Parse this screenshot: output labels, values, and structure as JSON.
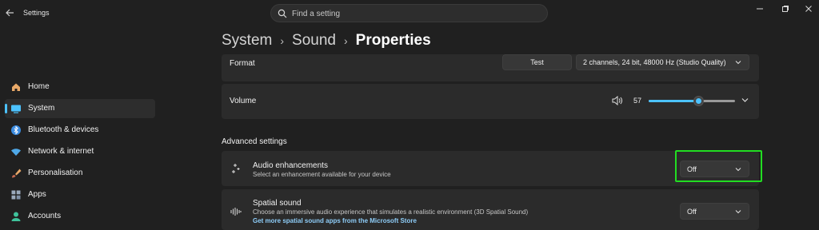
{
  "window": {
    "title": "Settings",
    "controls": [
      "minimize",
      "maximize",
      "close"
    ]
  },
  "search": {
    "placeholder": "Find a setting",
    "value": ""
  },
  "sidebar": {
    "items": [
      {
        "label": "Home",
        "icon": "home-icon",
        "active": false
      },
      {
        "label": "System",
        "icon": "monitor-icon",
        "active": true
      },
      {
        "label": "Bluetooth & devices",
        "icon": "bluetooth-icon",
        "active": false
      },
      {
        "label": "Network & internet",
        "icon": "wifi-icon",
        "active": false
      },
      {
        "label": "Personalisation",
        "icon": "brush-icon",
        "active": false
      },
      {
        "label": "Apps",
        "icon": "apps-icon",
        "active": false
      },
      {
        "label": "Accounts",
        "icon": "person-icon",
        "active": false
      }
    ]
  },
  "breadcrumb": [
    "System",
    "Sound",
    "Properties"
  ],
  "format": {
    "label": "Format",
    "test_label": "Test",
    "selected": "2 channels, 24 bit, 48000 Hz (Studio Quality)"
  },
  "volume": {
    "label": "Volume",
    "value": "57",
    "level": 0.57
  },
  "advanced": {
    "title": "Advanced settings",
    "audio_enhancements": {
      "label": "Audio enhancements",
      "description": "Select an enhancement available for your device",
      "selected": "Off"
    },
    "spatial_sound": {
      "label": "Spatial sound",
      "description": "Choose an immersive audio experience that simulates a realistic environment (3D Spatial Sound)",
      "link": "Get more spatial sound apps from the Microsoft Store",
      "selected": "Off"
    }
  },
  "colors": {
    "accent": "#4cc2ff",
    "highlight": "#22dd22",
    "background": "#202020",
    "card": "#2b2b2b"
  }
}
